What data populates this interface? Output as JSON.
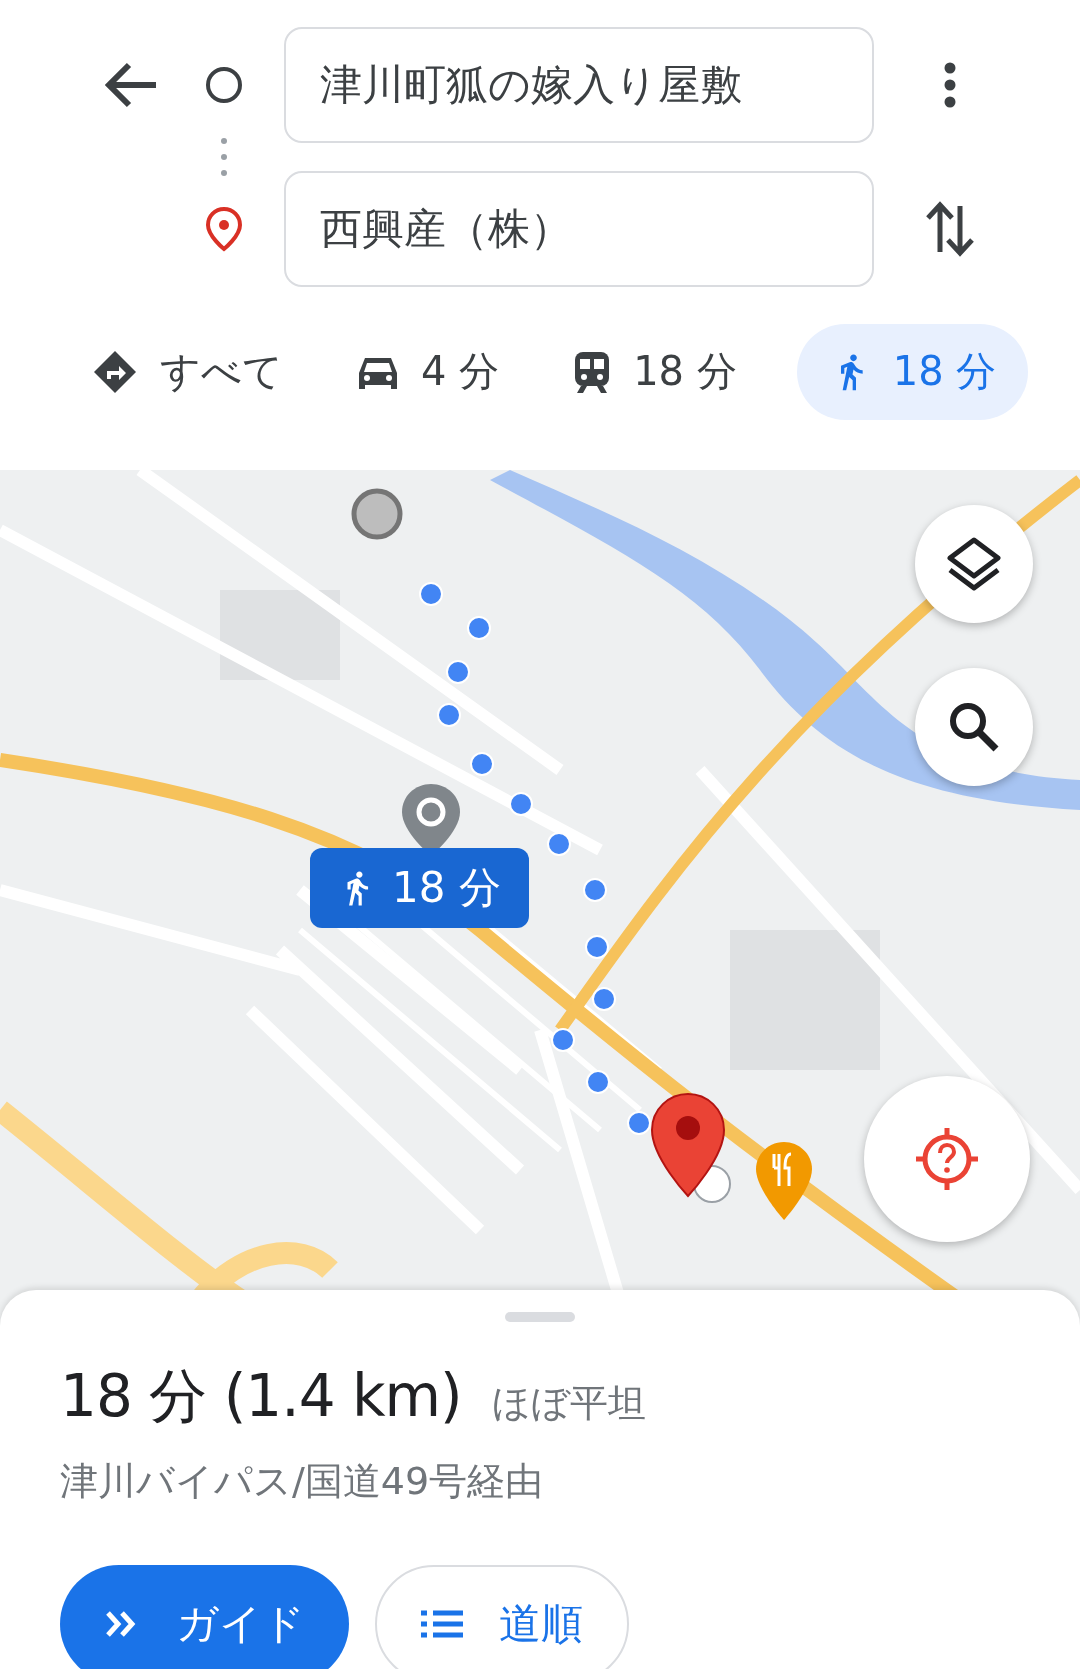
{
  "origin": {
    "value": "津川町狐の嫁入り屋敷"
  },
  "destination": {
    "value": "西興産（株）"
  },
  "modes": [
    {
      "kind": "all",
      "label": "すべて",
      "selected": false
    },
    {
      "kind": "car",
      "label": "4 分",
      "selected": false
    },
    {
      "kind": "transit",
      "label": "18 分",
      "selected": false
    },
    {
      "kind": "walk",
      "label": "18 分",
      "selected": true
    }
  ],
  "map": {
    "kind": "picture",
    "route_label": "18 分"
  },
  "summary": {
    "duration": "18 分 (1.4 km)",
    "terrain": "ほぼ平坦",
    "via": "津川バイパス/国道49号経由"
  },
  "buttons": [
    {
      "kind": "guide",
      "label": "ガイド"
    },
    {
      "kind": "steps",
      "label": "道順"
    }
  ]
}
